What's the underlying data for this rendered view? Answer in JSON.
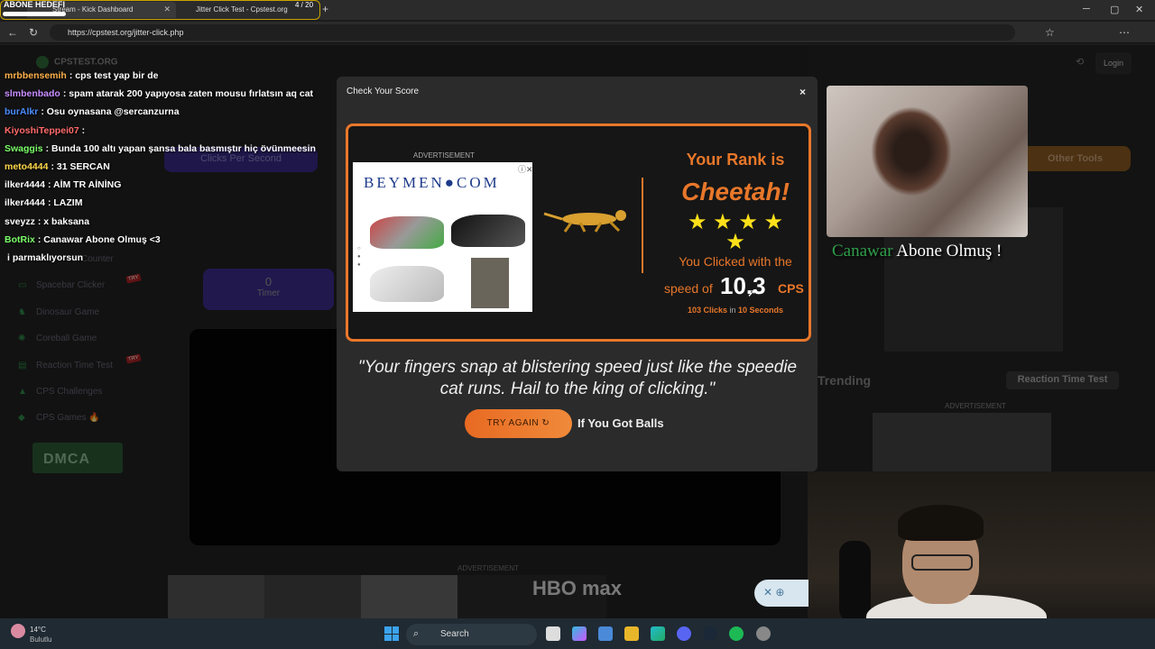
{
  "browser": {
    "tabs": [
      {
        "label": "Stream - Kick Dashboard"
      },
      {
        "label": "Jitter Click Test - Cpstest.org"
      }
    ],
    "url": "https://cpstest.org/jitter-click.php",
    "goal": {
      "label": "ABONE HEDEFI",
      "count": "4 / 20",
      "progress": 0.2
    }
  },
  "site": {
    "logo": "CPSTEST.ORG",
    "login": "Login",
    "sidebar": [
      {
        "label": "Spacebar Clicker",
        "try": "TRY"
      },
      {
        "label": "Dinosaur Game",
        "try": ""
      },
      {
        "label": "Coreball Game",
        "try": ""
      },
      {
        "label": "Reaction Time Test",
        "try": "TRY"
      },
      {
        "label": "CPS Challenges",
        "try": ""
      },
      {
        "label": "CPS Games 🔥",
        "try": ""
      }
    ],
    "counter_label": "Counter",
    "dmca": "DMCA",
    "cps_tab": "Clicks Per Second",
    "timer_value": "0",
    "timer_label": "Timer",
    "other_tools": "Other Tools",
    "trending": "Trending",
    "reaction_button": "Reaction Time Test",
    "ad_label": "ADVERTISEMENT",
    "bottom_ad_brand": "HBO max"
  },
  "chat": [
    {
      "user": "mrbbensemih",
      "color": "#ffb14a",
      "msg": ": cps test yap bir de"
    },
    {
      "user": "slmbenbado",
      "color": "#c88cff",
      "msg": ": spam atarak 200 yapıyosa zaten mousu fırlatsın aq cat"
    },
    {
      "user": "burAlkr",
      "color": "#4a8cff",
      "msg": ": Osu oynasana @sercanzurna"
    },
    {
      "user": "KiyoshiTeppei07",
      "color": "#ff6a6a",
      "msg": ":"
    },
    {
      "user": "Swaggis",
      "color": "#7cff6a",
      "msg": ": Bunda 100 altı yapan şansa bala basmıştır hiç övünmeesin"
    },
    {
      "user": "meto4444",
      "color": "#ffd84a",
      "msg": ": 31 SERCAN"
    },
    {
      "user": "ilker4444",
      "color": "#ffffff",
      "msg": ": AİM TR AİNİNG"
    },
    {
      "user": "ilker4444",
      "color": "#ffffff",
      "msg": ": LAZIM"
    },
    {
      "user": "sveyzz",
      "color": "#ffffff",
      "msg": ": x baksana"
    },
    {
      "user": "BotRix",
      "color": "#7cff6a",
      "msg": ": Canawar Abone Olmuş <3"
    },
    {
      "user": "",
      "color": "#ffffff",
      "msg": "i parmaklıyorsun"
    }
  ],
  "modal": {
    "title": "Check Your Score",
    "close": "×",
    "ad_label": "ADVERTISEMENT",
    "ad_brand": "BEYMEN●COM",
    "rank_label": "Your Rank is",
    "rank_name": "Cheetah!",
    "stars": "★ ★ ★ ★ ★",
    "clicked_text": "You Clicked with the",
    "speed_label": "speed of",
    "speed_value": "10.3",
    "speed_unit": "CPS",
    "clicks": "103 Clicks",
    "in_text": " in ",
    "seconds": "10 Seconds",
    "quote": "\"Your fingers snap at blistering speed just like the speedie cat runs. Hail to the king of clicking.\"",
    "try_again": "TRY AGAIN ↻",
    "balls": "If You Got Balls"
  },
  "stream": {
    "caption_green": "Canawar",
    "caption_white": " Abone Olmuş !"
  },
  "taskbar": {
    "temp": "14°C",
    "weather": "Bulutlu",
    "search": "Search"
  }
}
